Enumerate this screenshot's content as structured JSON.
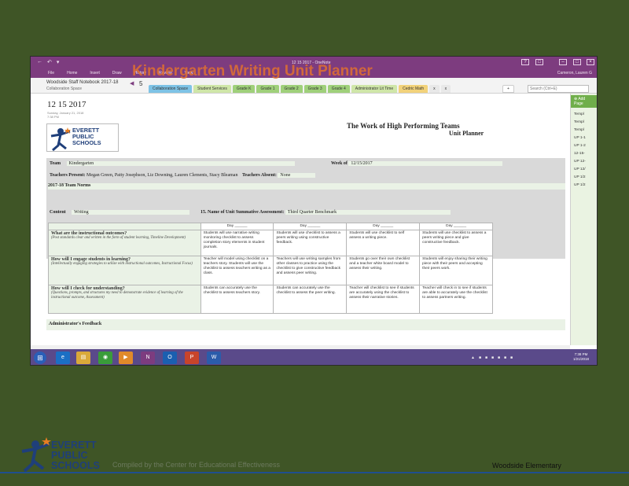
{
  "slide": {
    "title": "Kindergarten Writing Unit Planner",
    "logo_lines": [
      "EVERETT",
      "PUBLIC",
      "SCHOOLS"
    ],
    "compiled_by": "Compiled by the Center for Educational Effectiveness",
    "school": "Woodside Elementary"
  },
  "window": {
    "title": "12 15 2017 - OneNote",
    "menu": [
      "File",
      "Home",
      "Insert",
      "Draw",
      "History",
      "Review",
      "View"
    ],
    "user": "Cameron, Lauren G"
  },
  "notebook": {
    "name": "Woodside Staff Notebook 2017-18",
    "section": "Collaboration Space",
    "page_count": "5",
    "tabs": [
      {
        "label": "Collaboration Space",
        "color": "#7ec3e6"
      },
      {
        "label": "Student Services",
        "color": "#cfe6a8"
      },
      {
        "label": "Grade K",
        "color": "#9fd07a"
      },
      {
        "label": "Grade 1",
        "color": "#9fd07a"
      },
      {
        "label": "Grade 2",
        "color": "#9fd07a"
      },
      {
        "label": "Grade 3",
        "color": "#9fd07a"
      },
      {
        "label": "Grade 4",
        "color": "#9fd07a"
      },
      {
        "label": "Administrator Lit Time",
        "color": "#cfe6a8"
      },
      {
        "label": "Cedric Math",
        "color": "#f2d27a"
      },
      {
        "label": "x",
        "color": "#e8e8e8"
      },
      {
        "label": "x",
        "color": "#e8e8e8"
      }
    ],
    "search_placeholder": "Search (Ctrl+E)"
  },
  "page": {
    "title": "12 15 2017",
    "date_line": "Sunday, January 21, 2018",
    "time_line": "7:38 PM",
    "heading1": "The Work of High Performing Teams",
    "heading2": "Unit Planner",
    "team_label": "Team",
    "team_value": "Kindergarten",
    "week_label": "Week of",
    "week_value": "12/15/2017",
    "present_label": "Teachers Present:",
    "present_value": "Megan Green, Patty Josephson, Liz Downing, Lauren Clements, Stacy Bleaman",
    "absent_label": "Teachers Absent:",
    "absent_value": "None",
    "norms": "2017-18 Team Norms",
    "content_label": "Content",
    "content_value": "Writing",
    "assessment_label": "15. Name of Unit Summative Assessment:",
    "assessment_value": "Third Quarter Benchmark",
    "day_headers": [
      "Day ______",
      "Day ______",
      "Day ______",
      "Day ______"
    ],
    "rows": [
      {
        "q": "What are the instructional outcomes?",
        "sub": "(Post standards clear and written in the form of student learning, Timeline Development)",
        "cells": [
          "Students will use narrative writing monitoring checklist to assess completion story elements in student journals.",
          "Students will use checklist to assess a peers writing using constructive feedback.",
          "Students will use checklist to self assess a writing piece.",
          "Students will use checklist to assess a peers writing piece and give constructive feedback."
        ]
      },
      {
        "q": "How will I engage students in learning?",
        "sub": "(Intellectually engaging strategies to utilize with instructional outcomes, Instructional Focus)",
        "cells": [
          "Teacher will model using checklist on a teachers story. Students will use the checklist to assess teachers writing as a class.",
          "Teachers will use writing samples from other classes to practice using the checklist to give constructive feedback and assess peer writing.",
          "Students go over their own checklist and a teacher white board model to assess their writing.",
          "Students will enjoy sharing their writing piece with their peers and accepting their peers work."
        ]
      },
      {
        "q": "How will I check for understanding?",
        "sub": "(Questions, prompts, and structures my need to demonstrate evidence of learning of the instructional outcome, Assessment)",
        "cells": [
          "Students can accurately use the checklist to assess teachers story.",
          "Students can accurately use the checklist to assess the peer writing.",
          "Teacher will checklist to see if students are accurately using the checklist to assess their narrative stories.",
          "Teacher will check in to see if students are able to accurately use the checklist to assess partners writing."
        ]
      }
    ],
    "admin_feedback": "Administrator's Feedback"
  },
  "right_panel": {
    "add_label": "Add Page",
    "items": [
      "Templ",
      "Templ",
      "Templ",
      "UP 1-1",
      "UP 1-2",
      "12-15-",
      "UP 12-",
      "UP 12/",
      "UP 1/2",
      "UP 1/2"
    ]
  },
  "taskbar": {
    "time": "7:38 PM",
    "date": "1/21/2018",
    "apps": [
      "e",
      "file",
      "chrome",
      "media",
      "N",
      "O",
      "P",
      "W"
    ]
  }
}
